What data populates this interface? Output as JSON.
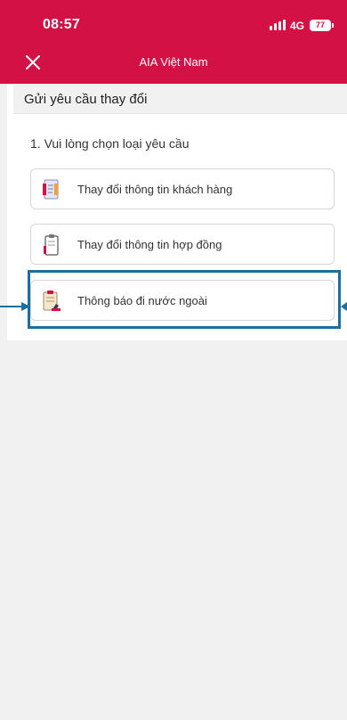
{
  "status_bar": {
    "time": "08:57",
    "network": "4G",
    "battery": "77"
  },
  "header": {
    "title": "AIA Việt Nam"
  },
  "page": {
    "heading": "Gửi yêu cầu thay đổi"
  },
  "form": {
    "question": "1. Vui lòng chọn loại yêu cầu",
    "options": [
      {
        "label": "Thay đổi thông tin khách hàng",
        "icon": "customer-info-icon"
      },
      {
        "label": "Thay đổi thông tin hợp đồng",
        "icon": "contract-clipboard-icon"
      },
      {
        "label": "Thông báo đi nước ngoài",
        "icon": "travel-notice-icon"
      }
    ]
  },
  "colors": {
    "brand": "#d31145",
    "highlight": "#1a6fa0",
    "background": "#f1f1f1"
  }
}
